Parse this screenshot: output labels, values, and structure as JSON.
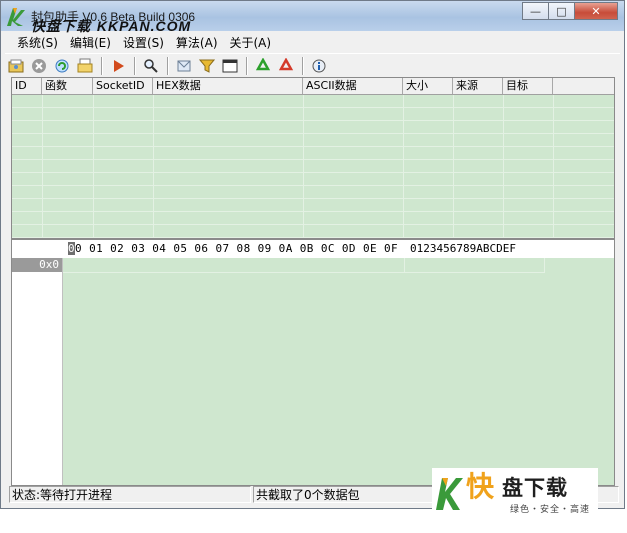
{
  "window": {
    "title": "封包助手 V0.6 Beta Build 0306",
    "watermark_top": {
      "cn": "快盘下载",
      "latin": "KKPAN.COM"
    },
    "buttons": {
      "minimize": "—",
      "maximize": "□",
      "close": "✕"
    }
  },
  "menu": {
    "items": [
      {
        "label": "系统(S)"
      },
      {
        "label": "编辑(E)"
      },
      {
        "label": "设置(S)"
      },
      {
        "label": "算法(A)"
      },
      {
        "label": "关于(A)"
      }
    ]
  },
  "toolbar": {
    "icons": [
      "open-icon",
      "stop-icon",
      "refresh-icon",
      "folder-icon",
      "play-icon",
      "search-icon",
      "send-icon",
      "filter-icon",
      "window-icon",
      "recycle-green-icon",
      "recycle-red-icon",
      "info-icon"
    ]
  },
  "packet_list": {
    "columns": [
      "ID",
      "函数",
      "SocketID",
      "HEX数据",
      "ASCII数据",
      "大小",
      "来源",
      "目标"
    ]
  },
  "hex_view": {
    "cursor": "0",
    "header_hex": "0 01 02 03 04 05 06 07 08 09 0A 0B 0C 0D 0E 0F",
    "header_ascii": "0123456789ABCDEF",
    "address": "0x0"
  },
  "status": {
    "left": "状态:等待打开进程",
    "right": "共截取了0个数据包"
  },
  "brand": {
    "glyph": "快",
    "name": "盘下载",
    "slogan": "绿色・安全・高速",
    "colors": {
      "accent": "#f0a21b",
      "green": "#3a9a3a"
    }
  }
}
